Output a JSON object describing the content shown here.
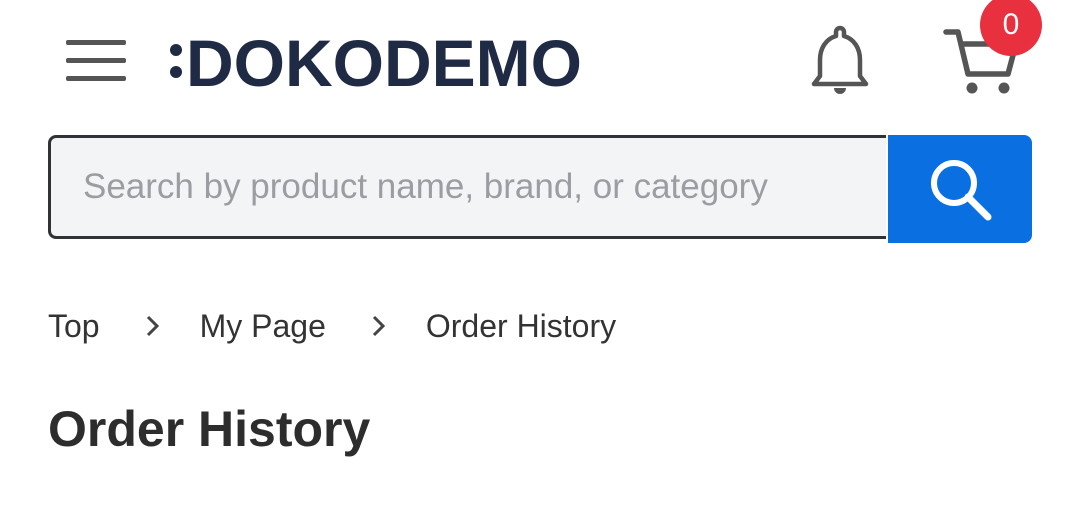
{
  "header": {
    "logo_text": "DOKODEMO",
    "menu_icon": "hamburger-menu-icon",
    "notification_icon": "bell-icon",
    "cart_icon": "shopping-cart-icon",
    "cart_count": "0"
  },
  "search": {
    "placeholder": "Search by product name, brand, or category",
    "value": "",
    "button_icon": "search-icon"
  },
  "breadcrumb": {
    "items": [
      "Top",
      "My Page",
      "Order History"
    ],
    "separator_icon": "chevron-right-icon"
  },
  "page": {
    "title": "Order History"
  },
  "colors": {
    "logo": "#1f2a44",
    "search_button": "#0a6fe0",
    "badge": "#e8303f",
    "icon_gray": "#555555"
  }
}
